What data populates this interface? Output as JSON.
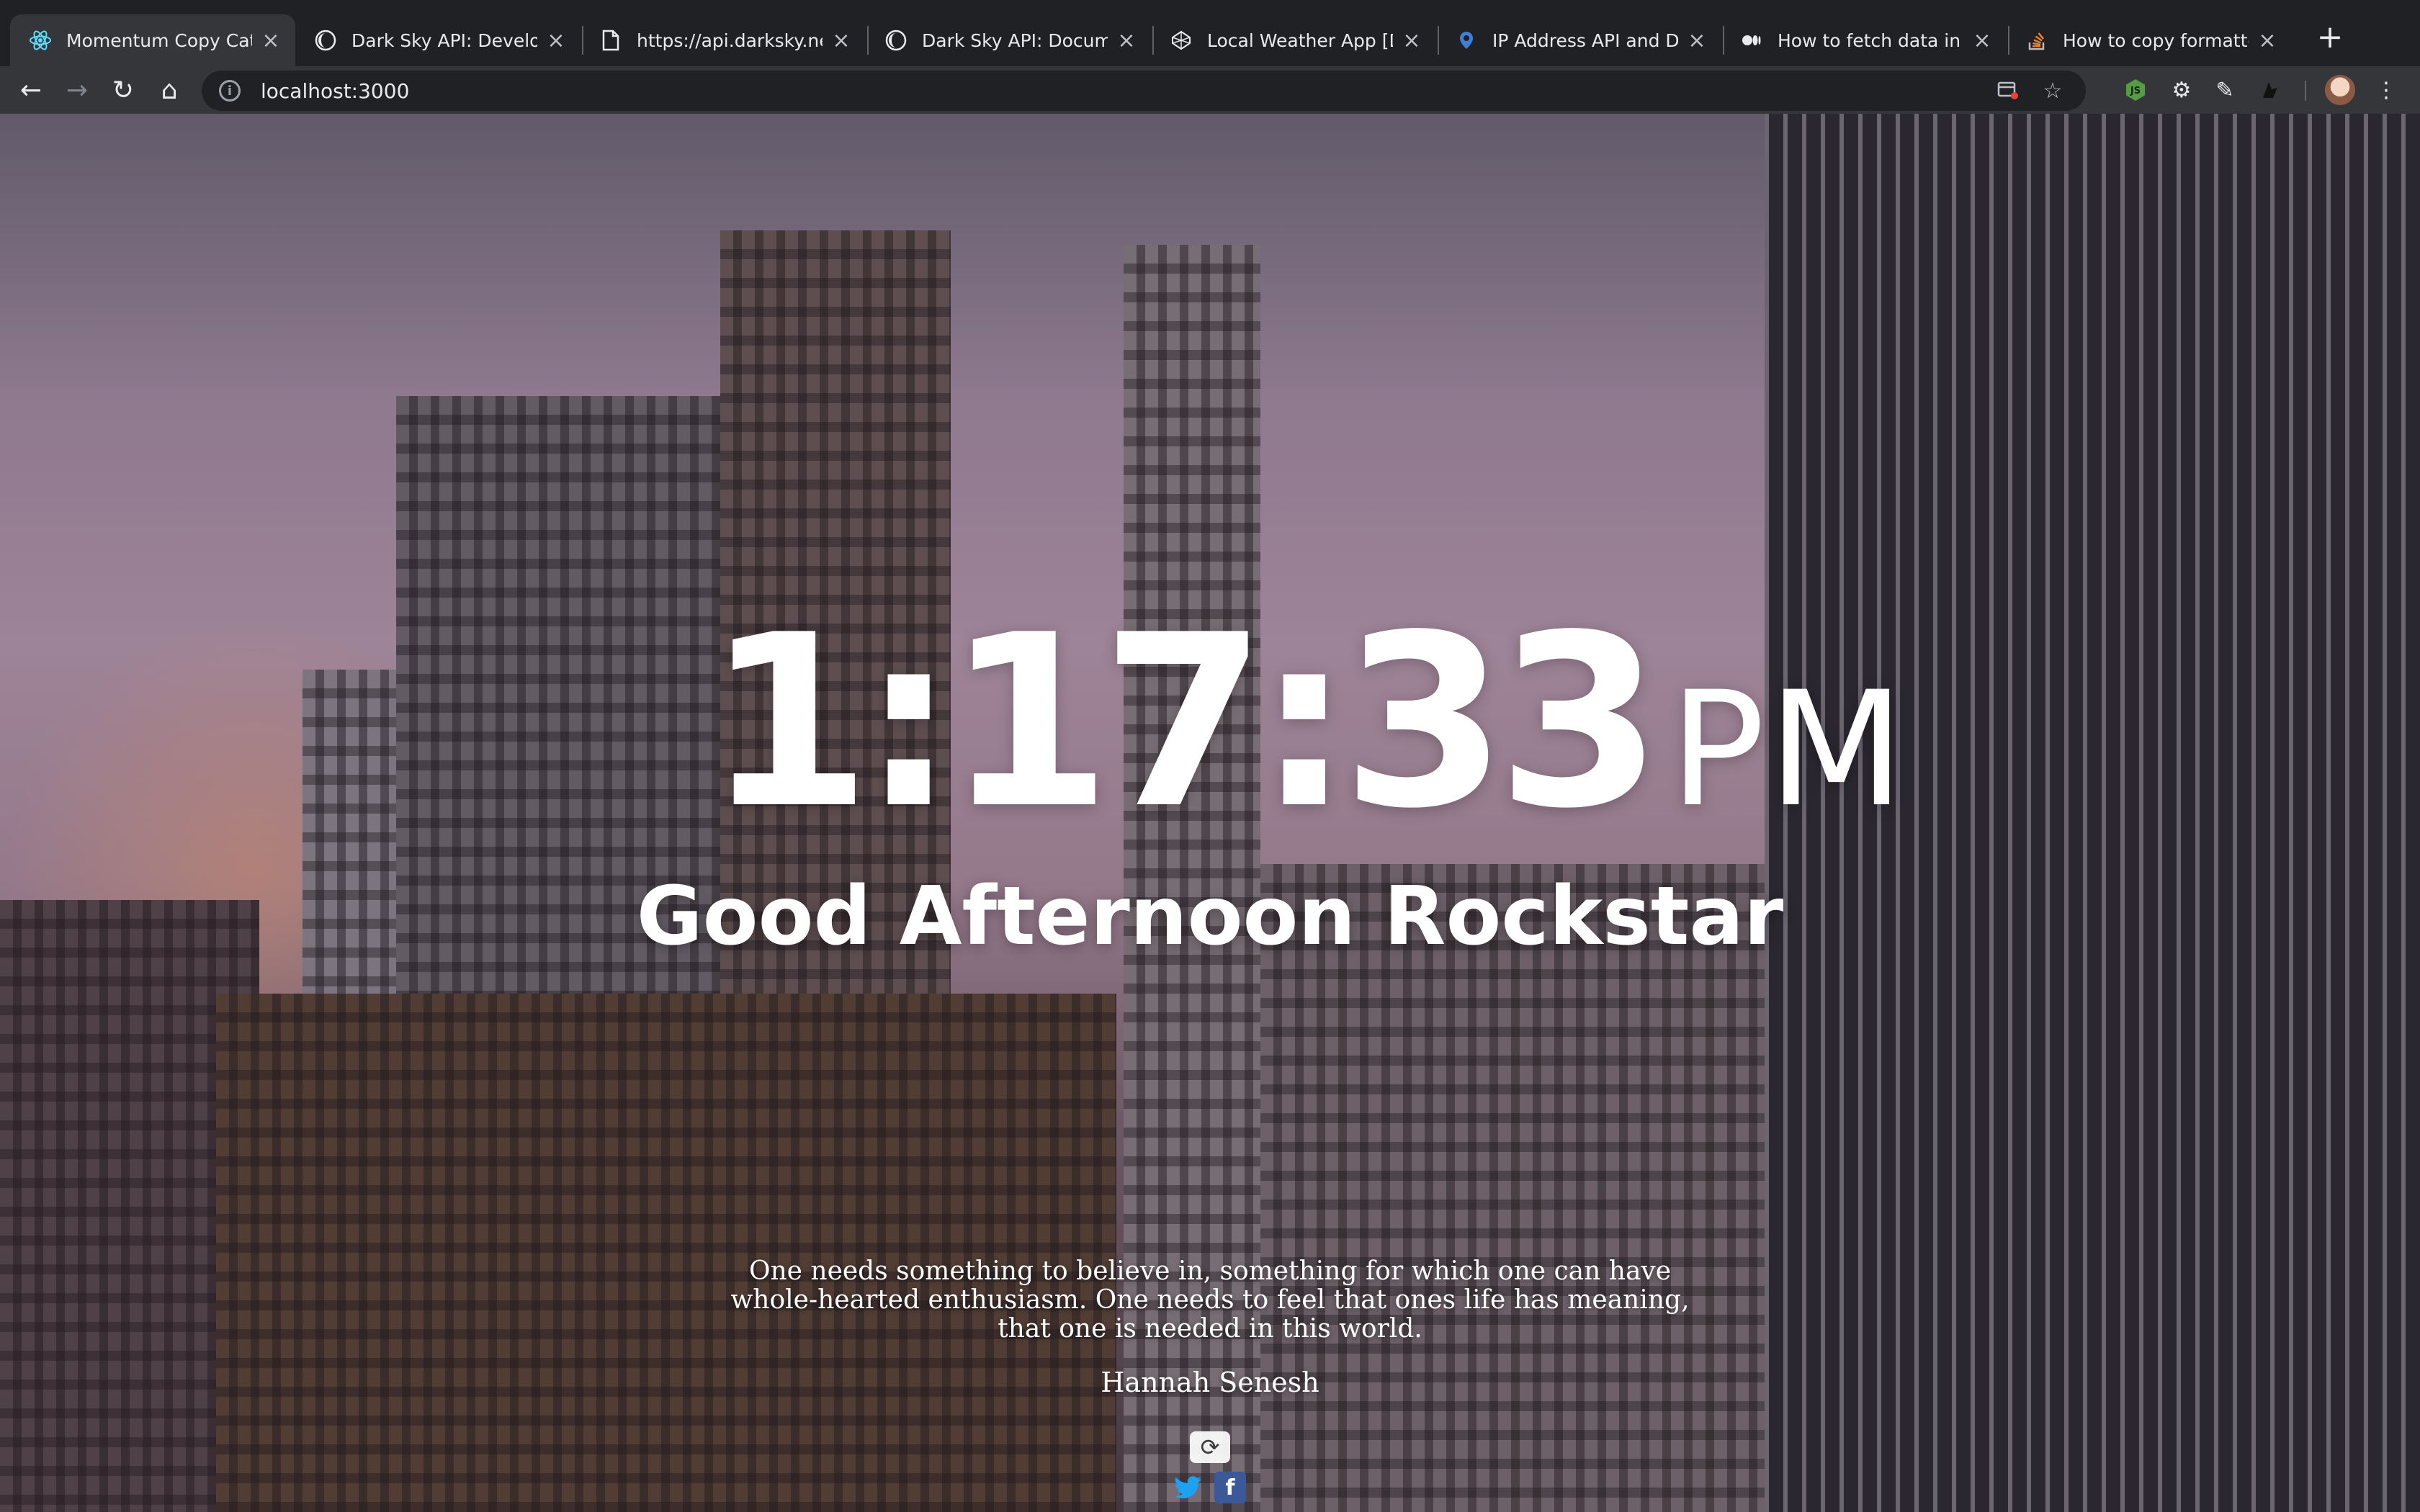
{
  "browser": {
    "tabs": [
      {
        "title": "Momentum Copy Cat 🐱",
        "favicon": "react-icon",
        "active": true
      },
      {
        "title": "Dark Sky API: Developers",
        "favicon": "darksky-icon",
        "active": false
      },
      {
        "title": "https://api.darksky.net/f",
        "favicon": "document-icon",
        "active": false
      },
      {
        "title": "Dark Sky API: Documentation",
        "favicon": "darksky-icon",
        "active": false
      },
      {
        "title": "Local Weather App [Dark",
        "favicon": "codepen-icon",
        "active": false
      },
      {
        "title": "IP Address API and Data",
        "favicon": "ipinfo-icon",
        "active": false
      },
      {
        "title": "How to fetch data in Re",
        "favicon": "medium-icon",
        "active": false
      },
      {
        "title": "How to copy formatted",
        "favicon": "stackoverflow-icon",
        "active": false
      }
    ],
    "tab_close_glyph": "×",
    "new_tab_glyph": "+",
    "address_bar": {
      "url": "localhost:3000"
    },
    "nav_glyphs": {
      "back": "←",
      "forward": "→",
      "reload": "↻",
      "home": "⌂",
      "menu": "⋮",
      "star": "☆"
    }
  },
  "momentum": {
    "time": "1:17:33",
    "ampm": "PM",
    "greeting": "Good Afternoon Rockstar",
    "quote": "One needs something to believe in, something for which one can have whole-hearted enthusiasm. One needs to feel that ones life has meaning, that one is needed in this world.",
    "author": "Hannah Senesh",
    "share": {
      "twitter": "twitter-icon",
      "facebook": "facebook-icon"
    }
  },
  "colors": {
    "tab_bar": "#202124",
    "toolbar": "#35363a",
    "twitter": "#1da1f2",
    "facebook": "#3b5998"
  }
}
